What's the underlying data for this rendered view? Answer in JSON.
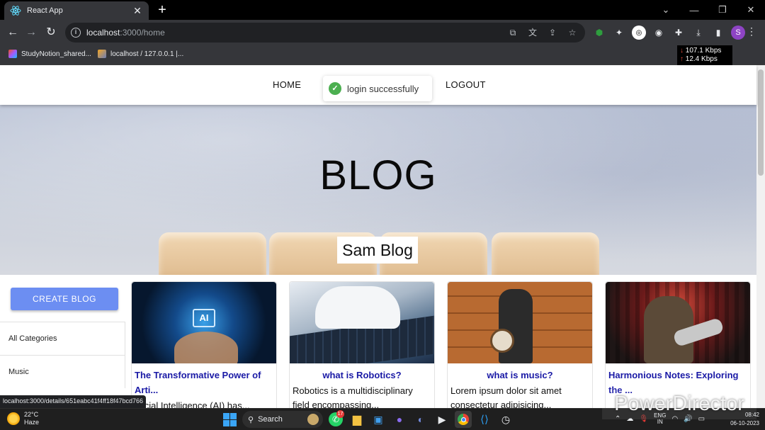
{
  "browser": {
    "tab_title": "React App",
    "tab_close": "✕",
    "new_tab": "+",
    "url_host": "localhost",
    "url_path": ":3000/home",
    "profile_initial": "S",
    "bookmarks": [
      "StudyNotion_shared...",
      "localhost / 127.0.0.1 |..."
    ],
    "net_down": "107.1 Kbps",
    "net_up": "12.4 Kbps",
    "status_url": "localhost:3000/details/651eabc41f4ff18f47bcd766"
  },
  "nav": {
    "home": "HOME",
    "logout": "LOGOUT"
  },
  "toast": {
    "message": "login successfully"
  },
  "hero": {
    "title": "BLOG",
    "subtitle": "Sam Blog"
  },
  "sidebar": {
    "create_label": "CREATE BLOG",
    "categories": [
      "All Categories",
      "Music"
    ]
  },
  "posts": [
    {
      "title": "The Transformative Power of Arti...",
      "desc": "...icial Intelligence (AI) has..."
    },
    {
      "title": "what is Robotics?",
      "desc": "Robotics is a multidisciplinary field encompassing..."
    },
    {
      "title": "what is music?",
      "desc": "Lorem ipsum dolor sit amet consectetur adipisicing..."
    },
    {
      "title": "Harmonious Notes: Exploring the ...",
      "desc": ""
    }
  ],
  "watermark": "PowerDirector",
  "taskbar": {
    "temp": "22°C",
    "condition": "Haze",
    "search_label": "Search",
    "whatsapp_badge": "17",
    "lang_top": "ENG",
    "lang_bottom": "IN",
    "time": "08:42",
    "date": "06-10-2023"
  },
  "colors": {
    "accent_button": "#6c8ef2",
    "post_title": "#1a1aa6",
    "toast_success": "#4caf50"
  }
}
